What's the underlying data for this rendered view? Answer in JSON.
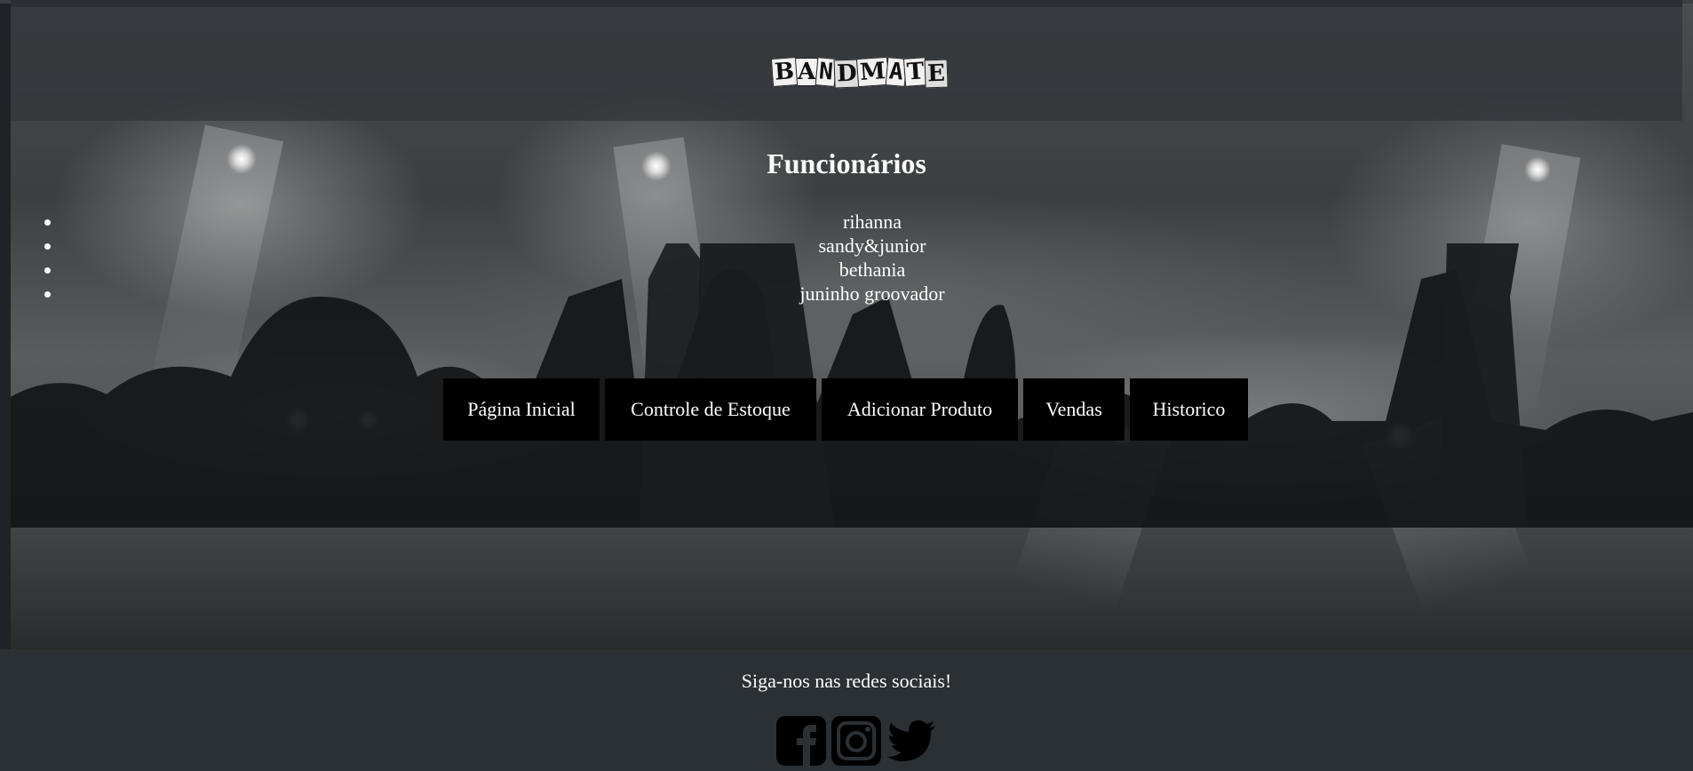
{
  "header": {
    "logo_text": "BANDMATE",
    "logo_letters": [
      "B",
      "A",
      "N",
      "D",
      "M",
      "A",
      "T",
      "E"
    ]
  },
  "main": {
    "title": "Funcionários",
    "employees": [
      "rihanna",
      "sandy&junior",
      "bethania",
      "juninho groovador"
    ]
  },
  "nav": {
    "items": [
      {
        "label": "Página Inicial"
      },
      {
        "label": "Controle de Estoque"
      },
      {
        "label": "Adicionar Produto"
      },
      {
        "label": "Vendas"
      },
      {
        "label": "Historico"
      }
    ]
  },
  "footer": {
    "text": "Siga-nos nas redes sociais!",
    "social_icons": [
      "facebook-icon",
      "instagram-icon",
      "twitter-icon"
    ]
  },
  "colors": {
    "header_bg": "#32363a",
    "footer_bg": "#2b3035",
    "button_bg": "#000000",
    "text": "#ffffff"
  }
}
